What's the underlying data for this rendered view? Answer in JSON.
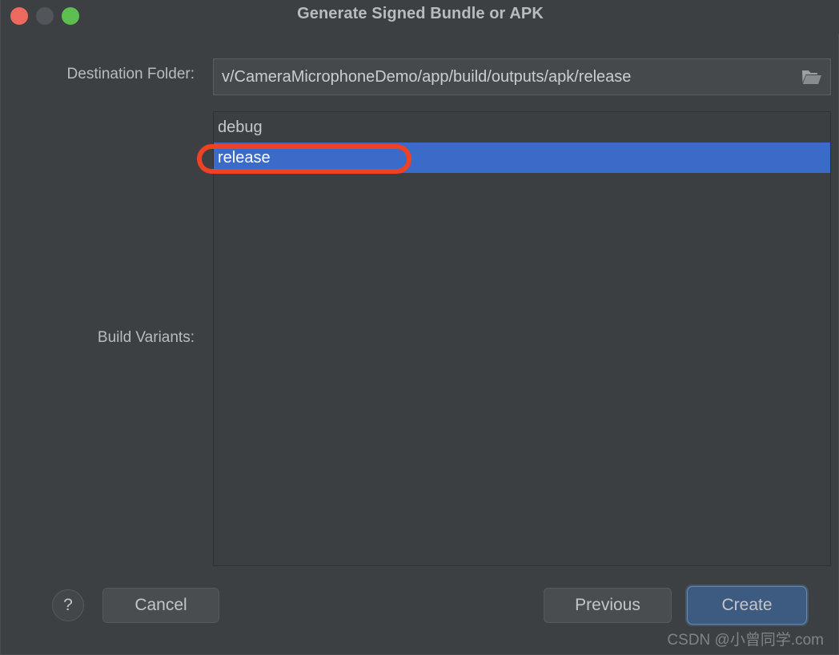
{
  "window": {
    "title": "Generate Signed Bundle or APK",
    "controls": {
      "close": "close-button",
      "minimize": "minimize-button",
      "maximize": "maximize-button"
    }
  },
  "destination": {
    "label": "Destination Folder:",
    "value": "v/CameraMicrophoneDemo/app/build/outputs/apk/release",
    "placeholder": "",
    "browse_icon": "folder-icon"
  },
  "build_variants": {
    "label": "Build Variants:",
    "items": [
      {
        "name": "debug",
        "selected": false
      },
      {
        "name": "release",
        "selected": true
      }
    ]
  },
  "annotation": {
    "color": "#ef4123",
    "target": "release"
  },
  "footer": {
    "help_label": "?",
    "cancel_label": "Cancel",
    "previous_label": "Previous",
    "create_label": "Create"
  },
  "watermark": "CSDN @小曾同学.com",
  "colors": {
    "dialog_background": "#3c4043",
    "selection_blue": "#3a6bc8",
    "default_button_blue": "#3d5a81",
    "traffic_close": "#ed6a5e",
    "traffic_min": "#51565a",
    "traffic_max": "#5dbf4f",
    "text_primary": "#b9bcbe"
  }
}
